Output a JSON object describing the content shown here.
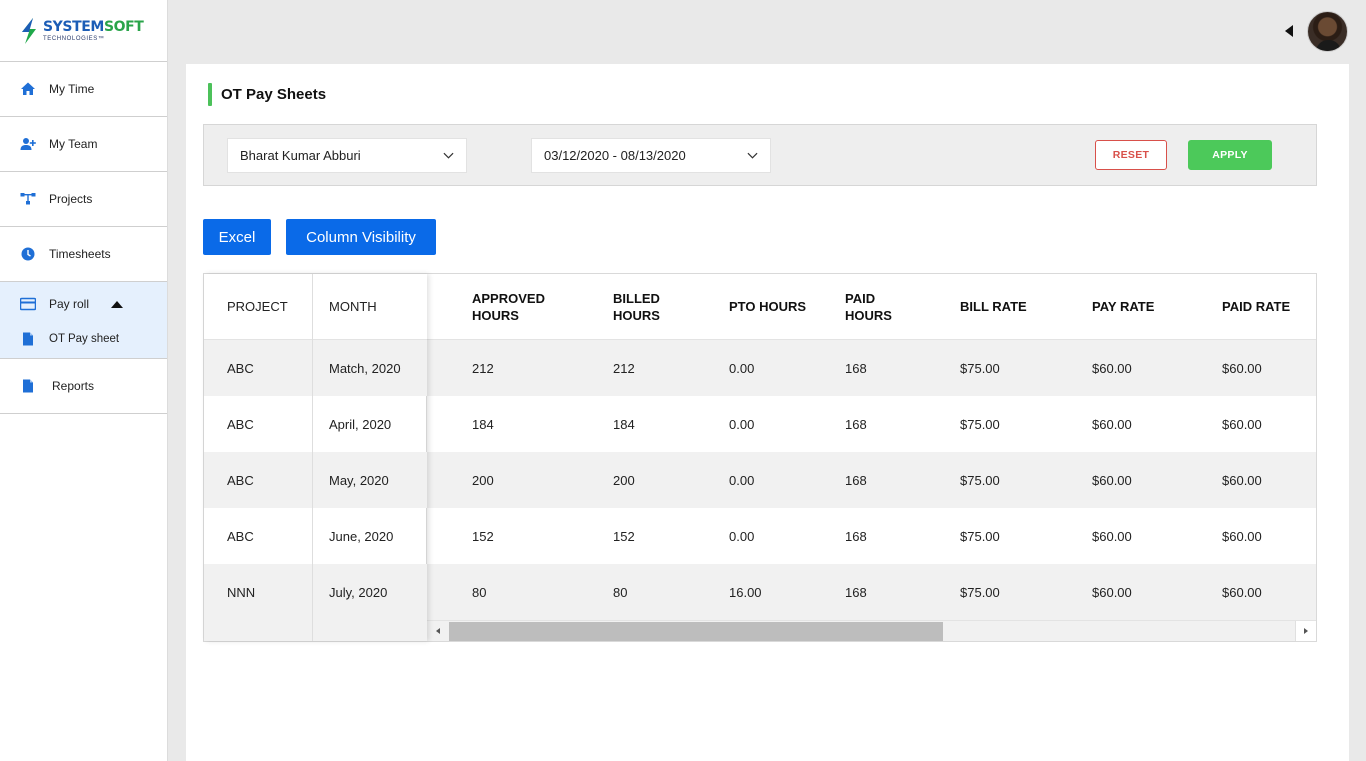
{
  "brand": {
    "name_part1": "SYSTEM",
    "name_part2": "SOFT",
    "subtitle": "TECHNOLOGIES™"
  },
  "sidebar": {
    "items": [
      {
        "label": "My Time",
        "icon": "home-icon"
      },
      {
        "label": "My Team",
        "icon": "add-user-icon"
      },
      {
        "label": "Projects",
        "icon": "sitemap-icon"
      },
      {
        "label": "Timesheets",
        "icon": "clock-icon"
      },
      {
        "label": "Pay roll",
        "icon": "credit-card-icon",
        "expanded": true,
        "children": [
          {
            "label": "OT Pay sheet",
            "icon": "document-icon"
          }
        ]
      },
      {
        "label": "Reports",
        "icon": "document-icon"
      }
    ]
  },
  "page": {
    "title": "OT Pay Sheets"
  },
  "filters": {
    "user": "Bharat Kumar Abburi",
    "date_range": "03/12/2020 - 08/13/2020",
    "reset_label": "RESET",
    "apply_label": "APPLY"
  },
  "actions": {
    "excel_label": "Excel",
    "column_visibility_label": "Column Visibility"
  },
  "colors": {
    "accent_green": "#4cc15a",
    "primary_blue": "#0a6ae8",
    "reset_red": "#d8504a",
    "active_nav_bg": "#e5f0fd"
  },
  "table": {
    "columns": [
      "PROJECT",
      "MONTH",
      "APPROVED HOURS",
      "BILLED HOURS",
      "PTO HOURS",
      "PAID HOURS",
      "BILL RATE",
      "PAY RATE",
      "PAID RATE"
    ],
    "rows": [
      [
        "ABC",
        "Match, 2020",
        "212",
        "212",
        "0.00",
        "168",
        "$75.00",
        "$60.00",
        "$60.00"
      ],
      [
        "ABC",
        "April, 2020",
        "184",
        "184",
        "0.00",
        "168",
        "$75.00",
        "$60.00",
        "$60.00"
      ],
      [
        "ABC",
        "May, 2020",
        "200",
        "200",
        "0.00",
        "168",
        "$75.00",
        "$60.00",
        "$60.00"
      ],
      [
        "ABC",
        "June, 2020",
        "152",
        "152",
        "0.00",
        "168",
        "$75.00",
        "$60.00",
        "$60.00"
      ],
      [
        "NNN",
        "July, 2020",
        "80",
        "80",
        "16.00",
        "168",
        "$75.00",
        "$60.00",
        "$60.00"
      ]
    ]
  }
}
